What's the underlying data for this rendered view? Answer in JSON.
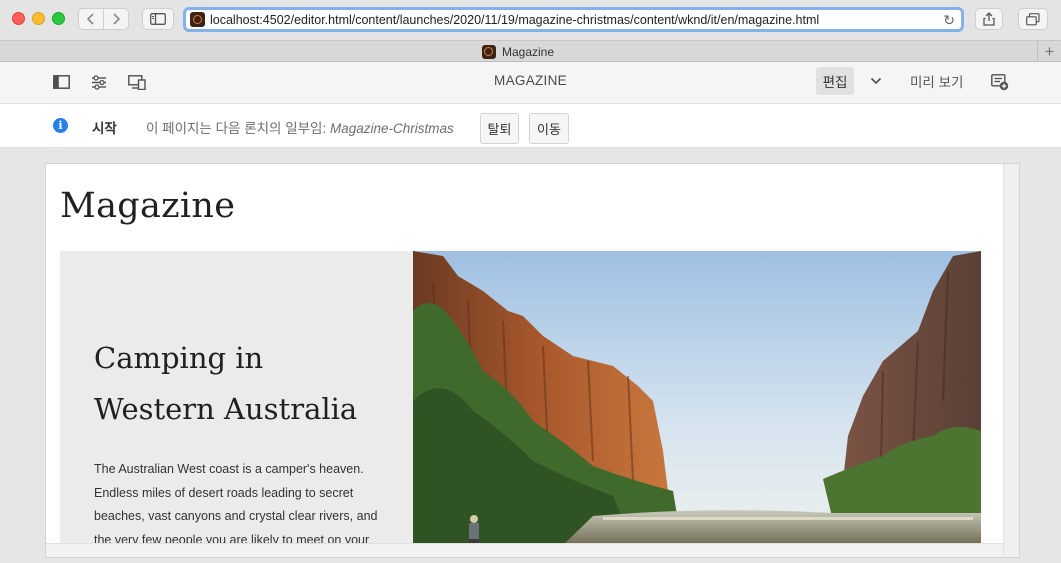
{
  "browser": {
    "url": "localhost:4502/editor.html/content/launches/2020/11/19/magazine-christmas/content/wknd/it/en/magazine.html",
    "tab_title": "Magazine",
    "nav_back_icon": "chevron-left-icon",
    "nav_forward_icon": "chevron-right-icon"
  },
  "editor": {
    "page_title": "MAGAZINE",
    "edit_label": "편집",
    "preview_label": "미리 보기",
    "icons": [
      "side-panel-icon",
      "page-properties-icon",
      "emulator-icon",
      "mode-chevron-icon",
      "annotations-icon"
    ]
  },
  "launch": {
    "label": "시작",
    "message_prefix": "이 페이지는 다음 론치의 일부임:",
    "launch_name": "Magazine-Christmas",
    "leave_label": "탈퇴",
    "move_label": "이동"
  },
  "content": {
    "title": "Magazine",
    "hero_title_line1": "Camping in",
    "hero_title_line2": "Western Australia",
    "hero_body_lines": [
      "The Australian West coast is a camper's heaven.",
      "Endless miles of desert roads leading to secret",
      "beaches, vast canyons and crystal clear rivers, and",
      "the very few people you are likely to meet on your"
    ]
  },
  "colors": {
    "info_blue": "#2680eb",
    "url_focus": "#84b1ea"
  }
}
